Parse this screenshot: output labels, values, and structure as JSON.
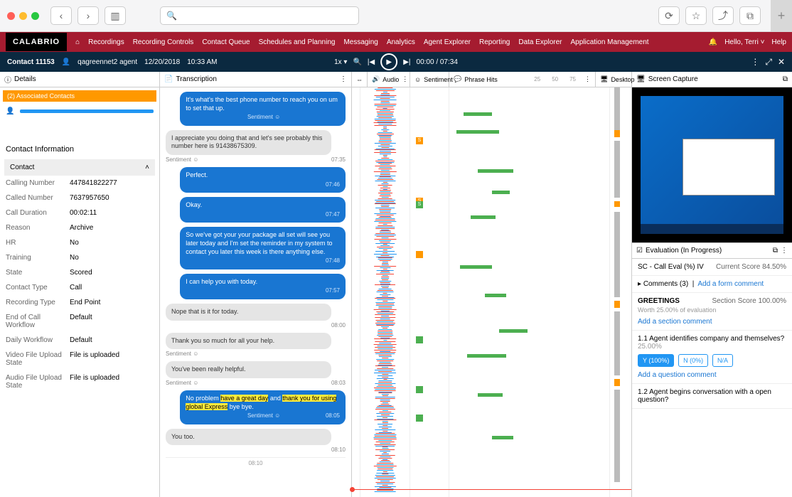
{
  "browser": {
    "search_icon": "🔍"
  },
  "nav": {
    "brand": "CALABRIO",
    "items": [
      "Recordings",
      "Recording Controls",
      "Contact Queue",
      "Schedules and Planning",
      "Messaging",
      "Analytics",
      "Agent Explorer",
      "Reporting",
      "Data Explorer",
      "Application Management"
    ],
    "user_greeting": "Hello, Terri",
    "help": "Help"
  },
  "subbar": {
    "contact_label": "Contact 11153",
    "agent": "qagreennet2 agent",
    "date": "12/20/2018",
    "time": "10:33 AM",
    "speed": "1x",
    "position": "00:00 / 07:34"
  },
  "details": {
    "header": "Details",
    "assoc": "(2) Associated Contacts",
    "section": "Contact Information",
    "expand": "Contact",
    "rows": [
      {
        "label": "Calling Number",
        "value": "447841822277"
      },
      {
        "label": "Called Number",
        "value": "7637957650"
      },
      {
        "label": "Call Duration",
        "value": "00:02:11"
      },
      {
        "label": "Reason",
        "value": "Archive"
      },
      {
        "label": "HR",
        "value": "No"
      },
      {
        "label": "Training",
        "value": "No"
      },
      {
        "label": "State",
        "value": "Scored"
      },
      {
        "label": "Contact Type",
        "value": "Call"
      },
      {
        "label": "Recording Type",
        "value": "End Point"
      },
      {
        "label": "End of Call Workflow",
        "value": "Default"
      },
      {
        "label": "Daily Workflow",
        "value": "Default"
      },
      {
        "label": "Video File Upload State",
        "value": "File is uploaded"
      },
      {
        "label": "Audio File Upload State",
        "value": "File is uploaded"
      }
    ]
  },
  "transcription": {
    "header": "Transcription",
    "messages": [
      {
        "side": "agent",
        "text": "It's what's the best phone number to reach you on um to set that up.",
        "meta": "Sentiment ☺",
        "time": ""
      },
      {
        "side": "cust",
        "text": "I appreciate you doing that and let's see probably this number here is 91438675309.",
        "meta": "Sentiment ☺",
        "time": "07:35"
      },
      {
        "side": "agent",
        "text": "Perfect.",
        "meta": "",
        "time": "07:46"
      },
      {
        "side": "agent",
        "text": "Okay.",
        "meta": "",
        "time": "07:47"
      },
      {
        "side": "agent",
        "text": "So we've got your your package all set will see you later today and I'm set the reminder in my system to contact you later this week is there anything else.",
        "meta": "",
        "time": "07:48"
      },
      {
        "side": "agent",
        "text": "I can help you with today.",
        "meta": "",
        "time": "07:57"
      },
      {
        "side": "cust",
        "text": "Nope that is it for today.",
        "meta": "",
        "time": "08:00"
      },
      {
        "side": "cust",
        "text": "Thank you so much for all your help.",
        "meta": "Sentiment ☺",
        "time": ""
      },
      {
        "side": "cust",
        "text": "You've been really helpful.",
        "meta": "Sentiment ☺",
        "time": "08:03"
      },
      {
        "side": "agent",
        "text": "No problem <hl>have a great day</hl> and <hl>thank you for using global Express</hl> bye bye.",
        "meta": "Sentiment ☺",
        "time": "08:05"
      },
      {
        "side": "cust",
        "text": "You too.",
        "meta": "",
        "time": "08:10"
      }
    ],
    "footer_time": "08:10"
  },
  "viz": {
    "audio": "Audio",
    "sentiment": "Sentiment",
    "phrase": "Phrase Hits",
    "desktop": "Desktop",
    "ticks": [
      "25",
      "50",
      "75"
    ]
  },
  "screencap": {
    "header": "Screen Capture"
  },
  "eval": {
    "header": "Evaluation (In Progress)",
    "form_name": "SC - Call Eval (%) IV",
    "score_label": "Current Score",
    "score": "84.50%",
    "comments": "Comments (3)",
    "add_form": "Add a form comment",
    "section": "GREETINGS",
    "section_score_label": "Section Score",
    "section_score": "100.00%",
    "worth": "Worth 25.00% of evaluation",
    "add_section": "Add a section comment",
    "q1": "1.1 Agent identifies company and themselves?",
    "q1_weight": "25.00%",
    "btn_y": "Y (100%)",
    "btn_n": "N (0%)",
    "btn_na": "N/A",
    "add_question": "Add a question comment",
    "q2": "1.2 Agent begins conversation with a open question?"
  }
}
